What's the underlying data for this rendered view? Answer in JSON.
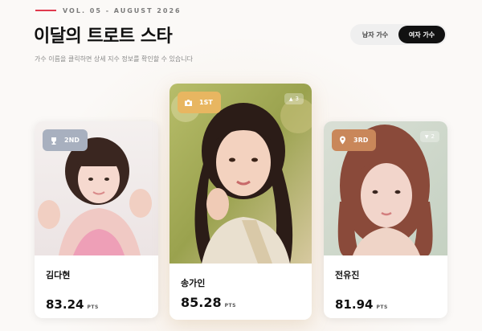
{
  "header": {
    "issue": "VOL. 05 - AUGUST 2026",
    "title": "이달의 트로트 스타",
    "subtitle": "가수 이름을 클릭하면 상세 지수 정보를 확인할 수 있습니다"
  },
  "toggle": {
    "options": [
      "남자 가수",
      "여자 가수"
    ],
    "active": "여자 가수"
  },
  "cards": [
    {
      "rank": "1ST",
      "rank_icon": "camera-icon",
      "badge_color": "#e8b661",
      "trend_icon": "arrow-up-icon",
      "trend": "3",
      "name": "송가인",
      "score": "85.28",
      "unit": "PTS"
    },
    {
      "rank": "2ND",
      "rank_icon": "trophy-icon",
      "badge_color": "#a8b0bf",
      "name": "김다현",
      "score": "83.24",
      "unit": "PTS"
    },
    {
      "rank": "3RD",
      "rank_icon": "location-pin-icon",
      "badge_color": "#c9875a",
      "trend_icon": "arrow-down-icon",
      "trend": "2",
      "name": "전유진",
      "score": "81.94",
      "unit": "PTS"
    }
  ]
}
